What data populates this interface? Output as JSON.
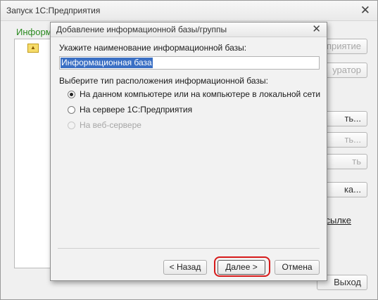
{
  "background_window": {
    "title": "Запуск 1С:Предприятия",
    "close_glyph": "✕",
    "list_caption": "Информ",
    "buttons": [
      {
        "label": "приятие",
        "disabled": true
      },
      {
        "label": "уратор",
        "disabled": true
      },
      {
        "label": "ть...",
        "disabled": false
      },
      {
        "label": "ть...",
        "disabled": true
      },
      {
        "label": "ть",
        "disabled": true
      },
      {
        "label": "ка...",
        "disabled": false
      },
      {
        "label": "Выход",
        "disabled": false
      }
    ],
    "link": "ссылке"
  },
  "dialog": {
    "title": "Добавление информационной базы/группы",
    "close_glyph": "✕",
    "name_prompt": "Укажите наименование информационной базы:",
    "name_value": "Информационная база",
    "location_prompt": "Выберите тип расположения информационной базы:",
    "options": [
      {
        "label": "На данном компьютере или на компьютере в локальной сети",
        "checked": true,
        "disabled": false
      },
      {
        "label": "На сервере 1С:Предприятия",
        "checked": false,
        "disabled": false
      },
      {
        "label": "На веб-сервере",
        "checked": false,
        "disabled": true
      }
    ],
    "buttons": {
      "back": "< Назад",
      "next": "Далее >",
      "cancel": "Отмена"
    }
  },
  "colors": {
    "highlight_ring": "#d61a1a",
    "caption_green": "#2a8a1f",
    "selection_blue": "#3a6fc4"
  }
}
